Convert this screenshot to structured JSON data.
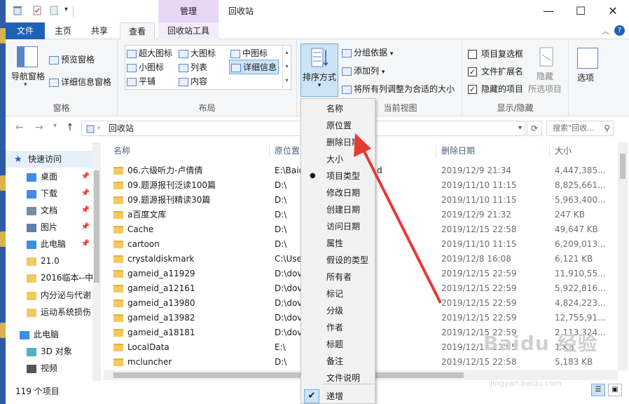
{
  "titlebar": {
    "context_tab_title": "管理",
    "window_title": "回收站",
    "minimize": "—",
    "maximize": "☐",
    "close": "✕"
  },
  "tabs": {
    "file": "文件",
    "home": "主页",
    "share": "共享",
    "view": "查看",
    "tools": "回收站工具",
    "help": "?"
  },
  "ribbon": {
    "panes": {
      "nav_pane": "导航窗格",
      "preview_pane": "预览窗格",
      "details_pane": "详细信息窗格",
      "label": "窗格"
    },
    "layout": {
      "xlarge_icons": "超大图标",
      "large_icons": "大图标",
      "medium_icons": "中图标",
      "small_icons": "小图标",
      "list": "列表",
      "details": "详细信息",
      "tiles": "平铺",
      "content": "内容",
      "label": "布局"
    },
    "current_view": {
      "sort_by": "排序方式",
      "group_by": "分组依据",
      "add_columns": "添加列",
      "size_columns": "将所有列调整为合适的大小",
      "label": "当前视图"
    },
    "show_hide": {
      "item_checkboxes": "项目复选框",
      "file_extensions": "文件扩展名",
      "hidden_items": "隐藏的项目",
      "hide": "隐藏",
      "hide_selected": "所选项目",
      "options": "选项",
      "label": "显示/隐藏",
      "item_checkboxes_checked": false,
      "file_extensions_checked": true,
      "hidden_items_checked": true
    }
  },
  "address": {
    "path": "回收站",
    "search_placeholder": "搜索\"回收..."
  },
  "navpane": {
    "items": [
      {
        "label": "快速访问",
        "icon": "star-icon",
        "pinned": false
      },
      {
        "label": "桌面",
        "icon": "desktop-icon",
        "pinned": true
      },
      {
        "label": "下载",
        "icon": "download-icon",
        "pinned": true
      },
      {
        "label": "文档",
        "icon": "document-icon",
        "pinned": true
      },
      {
        "label": "图片",
        "icon": "picture-icon",
        "pinned": true
      },
      {
        "label": "此电脑",
        "icon": "computer-icon",
        "pinned": true
      },
      {
        "label": "21.0",
        "icon": "folder-icon",
        "pinned": false
      },
      {
        "label": "2016临本--中",
        "icon": "folder-icon",
        "pinned": false
      },
      {
        "label": "内分泌与代谢",
        "icon": "folder-icon",
        "pinned": false
      },
      {
        "label": "运动系统损伤",
        "icon": "folder-icon",
        "pinned": false
      },
      {
        "label": "此电脑",
        "icon": "computer-icon",
        "pinned": false
      },
      {
        "label": "3D 对象",
        "icon": "cube-icon",
        "pinned": false
      },
      {
        "label": "视频",
        "icon": "video-icon",
        "pinned": false
      }
    ]
  },
  "filelist": {
    "headers": {
      "name": "名称",
      "location": "原位置",
      "date_deleted": "删除日期",
      "size": "大小"
    },
    "rows": [
      {
        "name": "06.六级听力-卢倩倩",
        "location": "E:\\Baid",
        "extra": "d",
        "date": "2019/12/9 21:34",
        "size": "4,447,385..."
      },
      {
        "name": "09.题源报刊泛读100篇",
        "location": "D:\\",
        "extra": "",
        "date": "2019/11/10 11:15",
        "size": "8,825,661..."
      },
      {
        "name": "09.题源报刊精读30篇",
        "location": "D:\\",
        "extra": "",
        "date": "2019/11/10 11:15",
        "size": "5,963,400..."
      },
      {
        "name": "a百度文库",
        "location": "D:\\",
        "extra": "",
        "date": "2019/12/9 21:32",
        "size": "247 KB"
      },
      {
        "name": "Cache",
        "location": "D:\\",
        "extra": "",
        "date": "2019/12/15 22:58",
        "size": "49,647 KB"
      },
      {
        "name": "cartoon",
        "location": "D:\\",
        "extra": "",
        "date": "2019/11/10 11:15",
        "size": "6,209,013..."
      },
      {
        "name": "crystaldiskmark",
        "location": "C:\\Use",
        "extra": "",
        "date": "2019/12/8 16:08",
        "size": "6,121 KB"
      },
      {
        "name": "gameid_a11929",
        "location": "D:\\dov",
        "extra": "",
        "date": "2019/12/15 22:59",
        "size": "11,910,55..."
      },
      {
        "name": "gameid_a12161",
        "location": "D:\\dov",
        "extra": "",
        "date": "2019/12/15 22:59",
        "size": "5,922,816..."
      },
      {
        "name": "gameid_a13980",
        "location": "D:\\dov",
        "extra": "",
        "date": "2019/12/15 22:59",
        "size": "4,824,223..."
      },
      {
        "name": "gameid_a13982",
        "location": "D:\\dov",
        "extra": "",
        "date": "2019/12/15 22:59",
        "size": "12,755,91..."
      },
      {
        "name": "gameid_a18181",
        "location": "D:\\dov",
        "extra": "",
        "date": "2019/12/15 22:59",
        "size": "2,113,324..."
      },
      {
        "name": "LocalData",
        "location": "E:\\",
        "extra": "",
        "date": "2019/12/15 23:05",
        "size": "1 KB"
      },
      {
        "name": "mcluncher",
        "location": "D:\\",
        "extra": "",
        "date": "2019/12/15 22:58",
        "size": "5,183 KB"
      }
    ]
  },
  "status": {
    "item_count": "119 个项目"
  },
  "sort_menu": {
    "items": [
      "名称",
      "原位置",
      "删除日期",
      "大小",
      "项目类型",
      "修改日期",
      "创建日期",
      "访问日期",
      "属性",
      "假设的类型",
      "所有者",
      "标记",
      "分级",
      "作者",
      "标题",
      "备注",
      "文件说明"
    ],
    "selected_index": 4,
    "ascending": "递增"
  },
  "watermark": {
    "brand": "Baidu 经验",
    "url": "jingyan.baidu.com"
  },
  "colors": {
    "accent": "#1e62b8",
    "context_tab": "#e8d6f5",
    "ribbon_bg": "#f5f6f7",
    "folder": "#f4c95d",
    "arrow": "#e53935",
    "selection": "#cde4f7"
  }
}
